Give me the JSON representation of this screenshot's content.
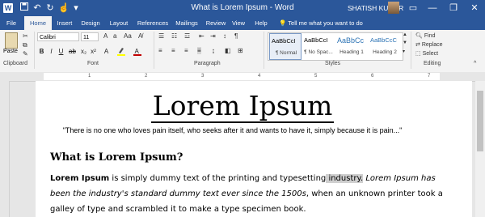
{
  "titlebar": {
    "app_logo": "W",
    "title": "What is Lorem Ipsum - Word",
    "user": "SHATISH KUMAR",
    "icons": [
      "save-icon",
      "undo-icon",
      "redo-icon",
      "touch-mode-icon",
      "customize-icon",
      "ribbon-display-icon",
      "minimize-icon",
      "restore-icon",
      "close-icon"
    ],
    "restore_glyph": "❐",
    "close_glyph": "✕",
    "minimize_glyph": "—",
    "ribbon_options_glyph": "▭"
  },
  "tabs": [
    "File",
    "Home",
    "Insert",
    "Design",
    "Layout",
    "References",
    "Mailings",
    "Review",
    "View",
    "Help"
  ],
  "active_tab": "Home",
  "tell_me": "Tell me what you want to do",
  "ribbon": {
    "clipboard": {
      "label": "Clipboard",
      "paste": "Paste"
    },
    "font": {
      "label": "Font",
      "name": "Calibri",
      "size": "11"
    },
    "paragraph": {
      "label": "Paragraph"
    },
    "styles": {
      "label": "Styles",
      "items": [
        {
          "sample": "AaBbCcI",
          "name": "¶ Normal"
        },
        {
          "sample": "AaBbCcI",
          "name": "¶ No Spac..."
        },
        {
          "sample": "AaBbCc",
          "name": "Heading 1"
        },
        {
          "sample": "AaBbCcC",
          "name": "Heading 2"
        }
      ]
    },
    "editing": {
      "label": "Editing",
      "find": "Find",
      "replace": "Replace",
      "select": "Select"
    }
  },
  "ruler_numbers": [
    "1",
    "2",
    "3",
    "4",
    "5",
    "6",
    "7"
  ],
  "document": {
    "title": "Lorem Ipsum",
    "quote": "\"There is no one who loves pain itself, who seeks after it and wants to have it, simply because it is pain...\"",
    "heading": "What is Lorem Ipsum?",
    "para_bold": "Lorem Ipsum",
    "para_text1": " is simply dummy text of the printing and typesetting",
    "para_highlight": " industry.",
    "para_italic": " Lorem Ipsum has been the industry's standard dummy text ever since the 1500s",
    "para_text2": ", when an unknown printer took a galley of type and scrambled it to make a type specimen book."
  },
  "colors": {
    "accent": "#2b579a",
    "font_color": "#c00000",
    "highlight": "#ffff00"
  }
}
